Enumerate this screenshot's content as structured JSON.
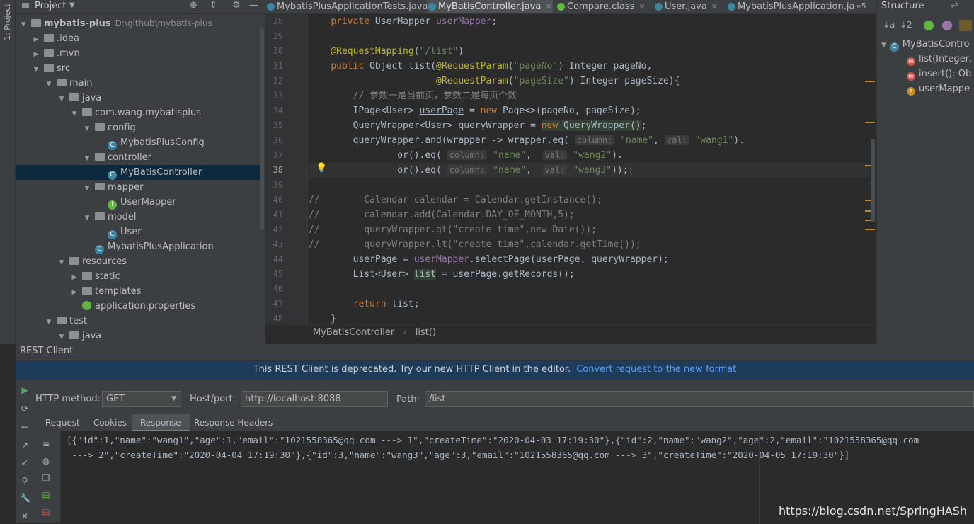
{
  "project_panel": {
    "title": "Project",
    "tree": [
      {
        "label": "mybatis-plus",
        "sub": "D:\\github\\mybatis-plus",
        "kind": "module",
        "depth": 0,
        "open": true
      },
      {
        "label": ".idea",
        "kind": "folder",
        "depth": 1,
        "open": false
      },
      {
        "label": ".mvn",
        "kind": "folder",
        "depth": 1,
        "open": false
      },
      {
        "label": "src",
        "kind": "folder",
        "depth": 1,
        "open": true
      },
      {
        "label": "main",
        "kind": "folder",
        "depth": 2,
        "open": true
      },
      {
        "label": "java",
        "kind": "folder",
        "depth": 3,
        "open": true
      },
      {
        "label": "com.wang.mybatisplus",
        "kind": "folder",
        "depth": 4,
        "open": true
      },
      {
        "label": "config",
        "kind": "folder",
        "depth": 5,
        "open": true
      },
      {
        "label": "MybatisPlusConfig",
        "kind": "class",
        "depth": 6
      },
      {
        "label": "controller",
        "kind": "folder",
        "depth": 5,
        "open": true
      },
      {
        "label": "MyBatisController",
        "kind": "class",
        "depth": 6,
        "selected": true
      },
      {
        "label": "mapper",
        "kind": "folder",
        "depth": 5,
        "open": true
      },
      {
        "label": "UserMapper",
        "kind": "interface",
        "depth": 6
      },
      {
        "label": "model",
        "kind": "folder",
        "depth": 5,
        "open": true
      },
      {
        "label": "User",
        "kind": "class",
        "depth": 6
      },
      {
        "label": "MybatisPlusApplication",
        "kind": "class",
        "depth": 5
      },
      {
        "label": "resources",
        "kind": "folder",
        "depth": 3,
        "open": true
      },
      {
        "label": "static",
        "kind": "folder",
        "depth": 4
      },
      {
        "label": "templates",
        "kind": "folder",
        "depth": 4
      },
      {
        "label": "application.properties",
        "kind": "file",
        "depth": 4
      },
      {
        "label": "test",
        "kind": "folder",
        "depth": 2,
        "open": true
      },
      {
        "label": "java",
        "kind": "folder",
        "depth": 3,
        "open": true
      }
    ]
  },
  "side_tab": "1: Project",
  "tabs": [
    {
      "label": "MybatisPlusApplicationTests.java",
      "active": false
    },
    {
      "label": "MyBatisController.java",
      "active": true
    },
    {
      "label": "Compare.class",
      "active": false
    },
    {
      "label": "User.java",
      "active": false
    },
    {
      "label": "MybatisPlusApplication.ja",
      "active": false
    }
  ],
  "tabs_overflow": "»5",
  "editor": {
    "current_line": 38,
    "lines": [
      {
        "n": 28
      },
      {
        "n": 29
      },
      {
        "n": 30
      },
      {
        "n": 31
      },
      {
        "n": 32
      },
      {
        "n": 33
      },
      {
        "n": 34
      },
      {
        "n": 35
      },
      {
        "n": 36
      },
      {
        "n": 37
      },
      {
        "n": 38
      },
      {
        "n": 39
      },
      {
        "n": 40
      },
      {
        "n": 41
      },
      {
        "n": 42
      },
      {
        "n": 43
      },
      {
        "n": 44
      },
      {
        "n": 45
      },
      {
        "n": 46
      },
      {
        "n": 47
      },
      {
        "n": 48
      }
    ]
  },
  "breadcrumb": {
    "class": "MyBatisController",
    "method": "list()"
  },
  "structure": {
    "title": "Structure",
    "items": [
      {
        "label": "MyBatisContro",
        "kind": "class"
      },
      {
        "label": "list(Integer,",
        "kind": "method"
      },
      {
        "label": "insert(): Ob",
        "kind": "method"
      },
      {
        "label": "userMappe",
        "kind": "field"
      }
    ]
  },
  "rest_client": {
    "title": "REST Client",
    "banner_text": "This REST Client is deprecated. Try our new HTTP Client in the editor.",
    "banner_link": "Convert request to the new format",
    "method_label": "HTTP method:",
    "method_value": "GET",
    "host_label": "Host/port:",
    "host_value": "http://localhost:8088",
    "path_label": "Path:",
    "path_value": "/list",
    "tabs": [
      "Request",
      "Cookies",
      "Response",
      "Response Headers"
    ],
    "active_tab": "Response",
    "response_line1": "[{\"id\":1,\"name\":\"wang1\",\"age\":1,\"email\":\"1021558365@qq.com ---> 1\",\"createTime\":\"2020-04-03 17:19:30\"},{\"id\":2,\"name\":\"wang2\",\"age\":2,\"email\":\"1021558365@qq.com",
    "response_line2": " ---> 2\",\"createTime\":\"2020-04-04 17:19:30\"},{\"id\":3,\"name\":\"wang3\",\"age\":3,\"email\":\"1021558365@qq.com ---> 3\",\"createTime\":\"2020-04-05 17:19:30\"}]"
  },
  "watermark": "https://blog.csdn.net/SpringHASh"
}
